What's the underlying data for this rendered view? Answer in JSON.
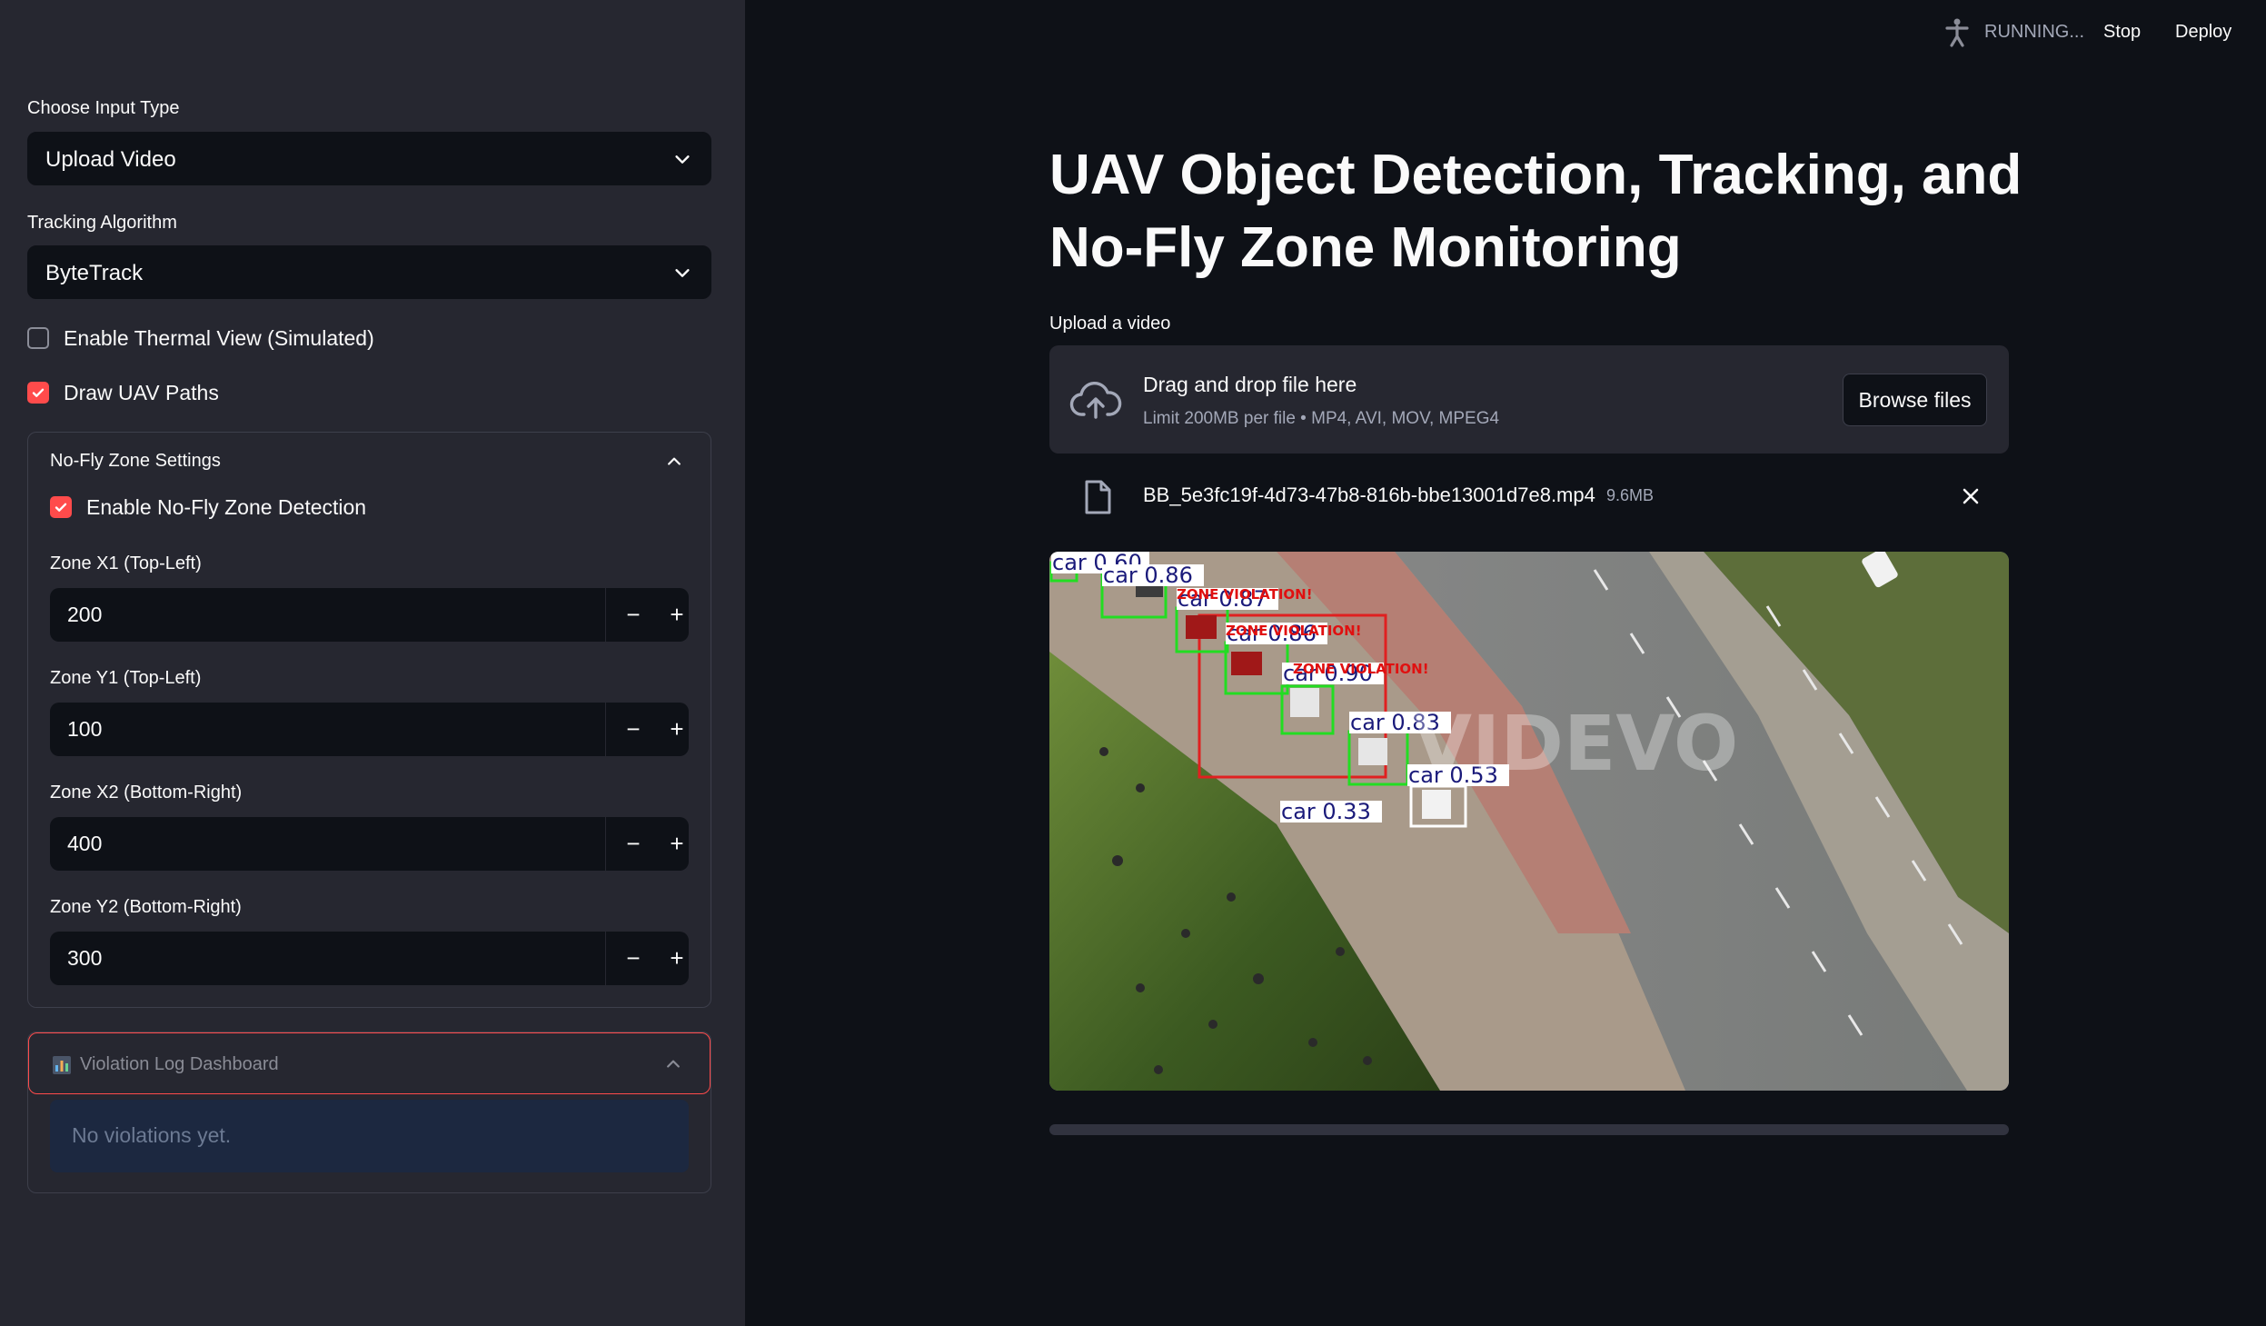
{
  "header": {
    "status": "RUNNING...",
    "stop_label": "Stop",
    "deploy_label": "Deploy"
  },
  "sidebar": {
    "input_type": {
      "label": "Choose Input Type",
      "value": "Upload Video"
    },
    "tracking": {
      "label": "Tracking Algorithm",
      "value": "ByteTrack"
    },
    "thermal": {
      "label": "Enable Thermal View (Simulated)",
      "checked": false
    },
    "uav_paths": {
      "label": "Draw UAV Paths",
      "checked": true
    },
    "nofly": {
      "title": "No-Fly Zone Settings",
      "enable": {
        "label": "Enable No-Fly Zone Detection",
        "checked": true
      },
      "fields": [
        {
          "label": "Zone X1 (Top-Left)",
          "value": "200"
        },
        {
          "label": "Zone Y1 (Top-Left)",
          "value": "100"
        },
        {
          "label": "Zone X2 (Bottom-Right)",
          "value": "400"
        },
        {
          "label": "Zone Y2 (Bottom-Right)",
          "value": "300"
        }
      ],
      "minus": "−",
      "plus": "+"
    },
    "log": {
      "title": "Violation Log Dashboard",
      "empty_text": "No violations yet."
    }
  },
  "main": {
    "title": "UAV Object Detection, Tracking, and No-Fly Zone Monitoring",
    "upload_label": "Upload a video",
    "dropzone": {
      "title": "Drag and drop file here",
      "hint": "Limit 200MB per file • MP4, AVI, MOV, MPEG4",
      "browse_label": "Browse files"
    },
    "file": {
      "name": "BB_5e3fc19f-4d73-47b8-816b-bbe13001d7e8.mp4",
      "size": "9.6MB"
    },
    "video": {
      "watermark": "VIDEVO",
      "detections": [
        {
          "label": "car 0.60"
        },
        {
          "label": "car 0.86"
        },
        {
          "label": "car 0.87"
        },
        {
          "label": "car 0.86"
        },
        {
          "label": "car 0.90"
        },
        {
          "label": "car 0.83"
        },
        {
          "label": "car 0.53"
        },
        {
          "label": "car 0.33"
        }
      ],
      "violation_text": "ZONE VIOLATION!"
    },
    "progress": 0.0
  }
}
